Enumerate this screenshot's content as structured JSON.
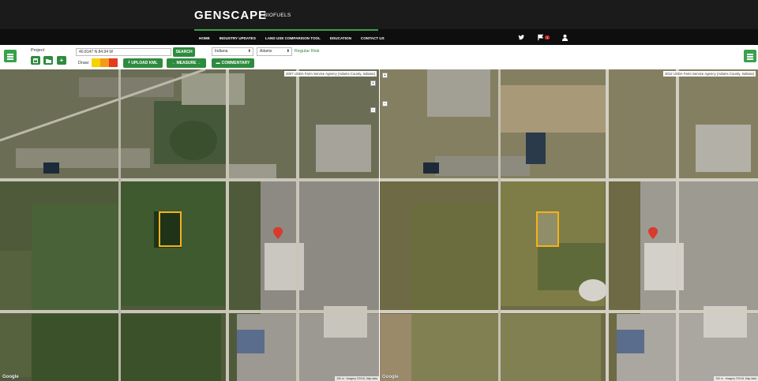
{
  "header": {
    "brand": "GENSCAPE",
    "brand_tm": "™",
    "product": "BIOFUELS"
  },
  "nav": {
    "items": [
      "HOME",
      "INDUSTRY UPDATES",
      "LAND USE COMPARISON TOOL",
      "EDUCATION",
      "CONTACT US"
    ],
    "alert_count": "1"
  },
  "toolbar": {
    "project_label": "Project",
    "coordinates_value": "40.8147 N 84.94 W",
    "search_label": "SEARCH",
    "draw_label": "Draw:",
    "draw_colors": [
      "#f5d300",
      "#f39a1a",
      "#e53a1e"
    ],
    "upload_label": "UPLOAD KML",
    "measure_label": "MEASURE",
    "commentary_label": "COMMENTARY",
    "state_value": "Indiana",
    "county_value": "Adams",
    "risk_label": "Regular Risk"
  },
  "maps": {
    "left_label": "2007 USDA Farm Service Agency (Adams County, Indiana)",
    "right_label": "2012 USDA Farm Service Agency (Adams County, Indiana)",
    "google_label": "Google",
    "scale_text": "100 m",
    "attribution": "Imagery ©2016, Map data"
  },
  "colors": {
    "accent": "#3aa14b",
    "header_bg": "#1b1b1b",
    "nav_bg": "#0e0e0e",
    "field_outline": "#f5b21a",
    "marker": "#d93a2b"
  }
}
